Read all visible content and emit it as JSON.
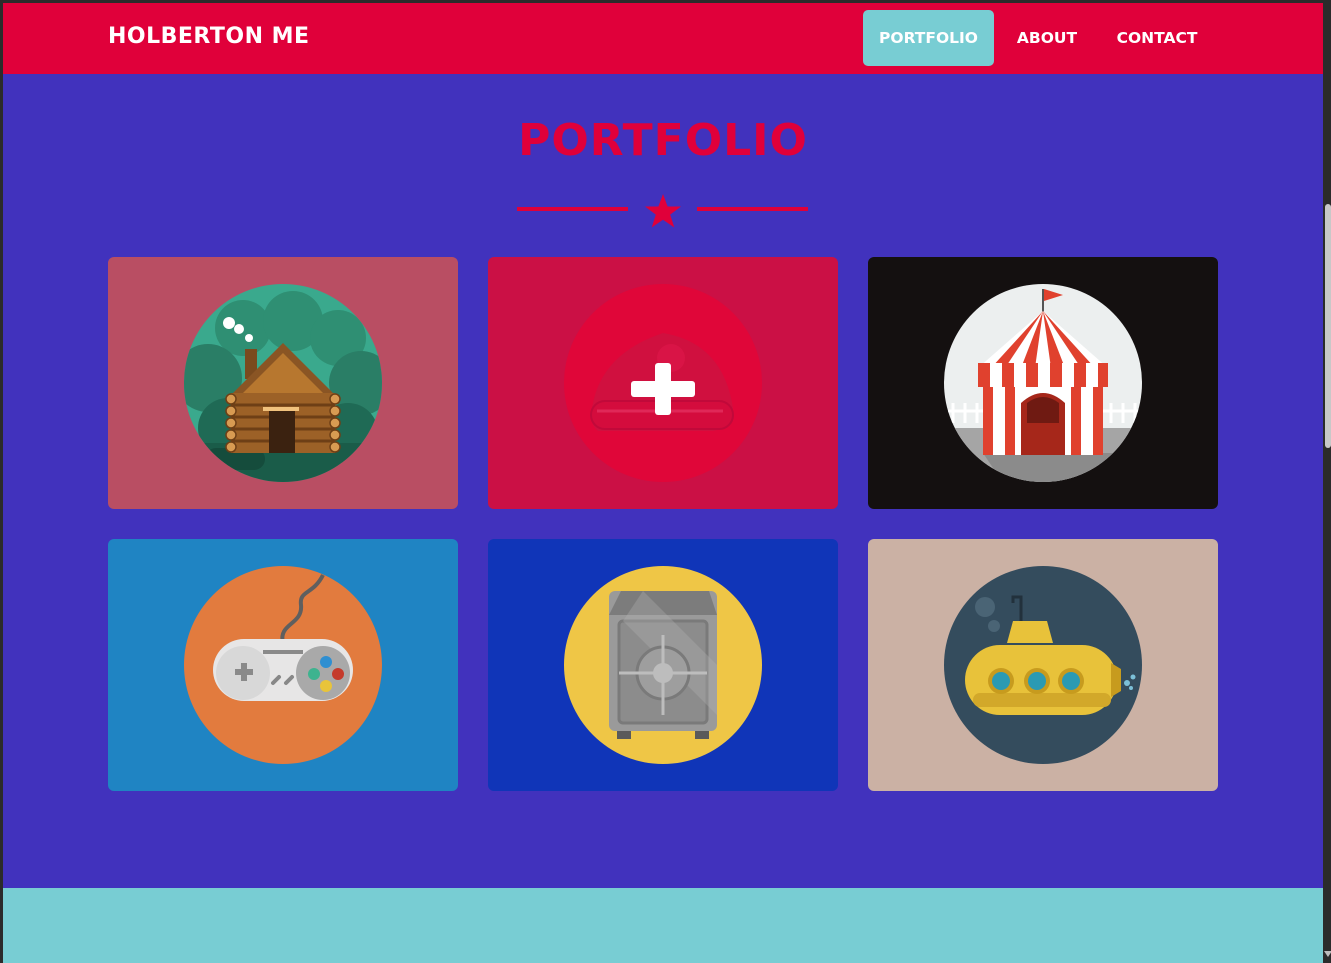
{
  "navbar": {
    "brand": "HOLBERTON ME",
    "items": [
      {
        "label": "PORTFOLIO",
        "active": true
      },
      {
        "label": "ABOUT",
        "active": false
      },
      {
        "label": "CONTACT",
        "active": false
      }
    ]
  },
  "portfolio": {
    "title": "PORTFOLIO",
    "divider_icon": "star-icon",
    "items": [
      {
        "icon": "cabin-icon",
        "background": "#b94e63"
      },
      {
        "icon": "cake-icon",
        "background": "#cb1045",
        "hover_icon": "plus-icon"
      },
      {
        "icon": "circus-tent-icon",
        "background": "#141010"
      },
      {
        "icon": "game-controller-icon",
        "background": "#1f84c3"
      },
      {
        "icon": "safe-icon",
        "background": "#1035b8"
      },
      {
        "icon": "submarine-icon",
        "background": "#cbb1a4"
      }
    ]
  },
  "colors": {
    "primary": "#e0003a",
    "page_background": "#4132bd",
    "accent": "#78cdd3"
  }
}
